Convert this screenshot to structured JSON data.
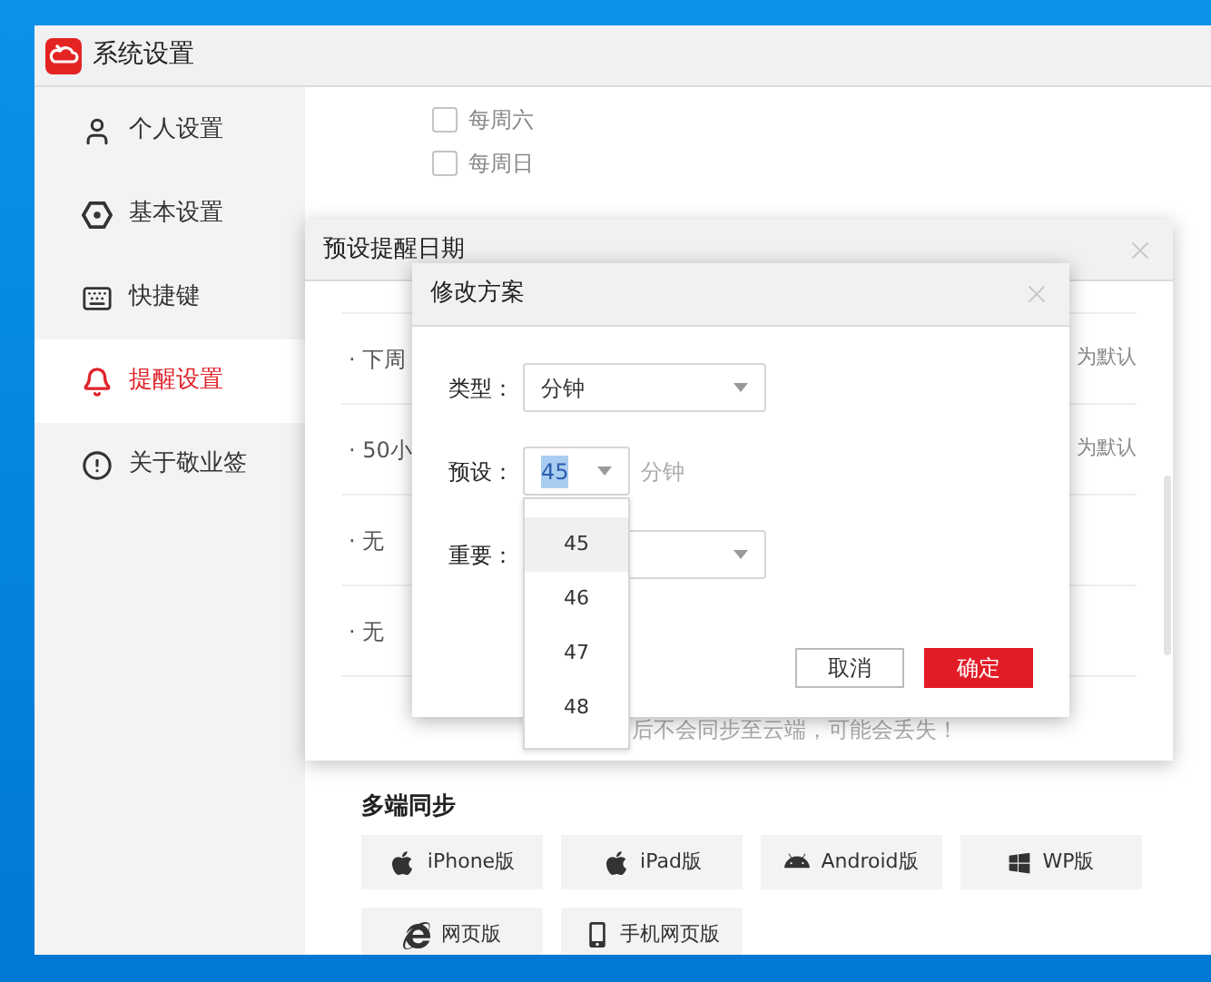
{
  "window": {
    "title": "系统设置"
  },
  "sidebar": {
    "items": [
      {
        "label": "个人设置",
        "selected": false
      },
      {
        "label": "基本设置",
        "selected": false
      },
      {
        "label": "快捷键",
        "selected": false
      },
      {
        "label": "提醒设置",
        "selected": true
      },
      {
        "label": "关于敬业签",
        "selected": false
      }
    ]
  },
  "weekdays": [
    {
      "label": "每周六",
      "checked": false
    },
    {
      "label": "每周日",
      "checked": false
    }
  ],
  "reminder_dialog": {
    "title": "预设提醒日期",
    "rows": [
      {
        "text": "· 下周",
        "action": "为默认"
      },
      {
        "text": "· 50小",
        "action": "为默认"
      },
      {
        "text": "· 无"
      },
      {
        "text": "· 无"
      }
    ],
    "notice": "后不会同步至云端，可能会丢失！"
  },
  "edit_dialog": {
    "title": "修改方案",
    "fields": [
      {
        "label": "类型：",
        "value": "分钟"
      },
      {
        "label": "预设：",
        "value": "45",
        "unit": "分钟"
      },
      {
        "label": "重要："
      }
    ],
    "options": [
      {
        "label": "45",
        "selected": true
      },
      {
        "label": "46",
        "selected": false
      },
      {
        "label": "47",
        "selected": false
      },
      {
        "label": "48",
        "selected": false
      }
    ],
    "buttons": [
      {
        "label": "取消",
        "kind": "secondary"
      },
      {
        "label": "确定",
        "kind": "primary"
      }
    ]
  },
  "sync": {
    "title": "多端同步",
    "buttons": [
      {
        "label": "iPhone版"
      },
      {
        "label": "iPad版"
      },
      {
        "label": "Android版"
      },
      {
        "label": "WP版"
      },
      {
        "label": "网页版"
      },
      {
        "label": "手机网页版"
      }
    ]
  }
}
